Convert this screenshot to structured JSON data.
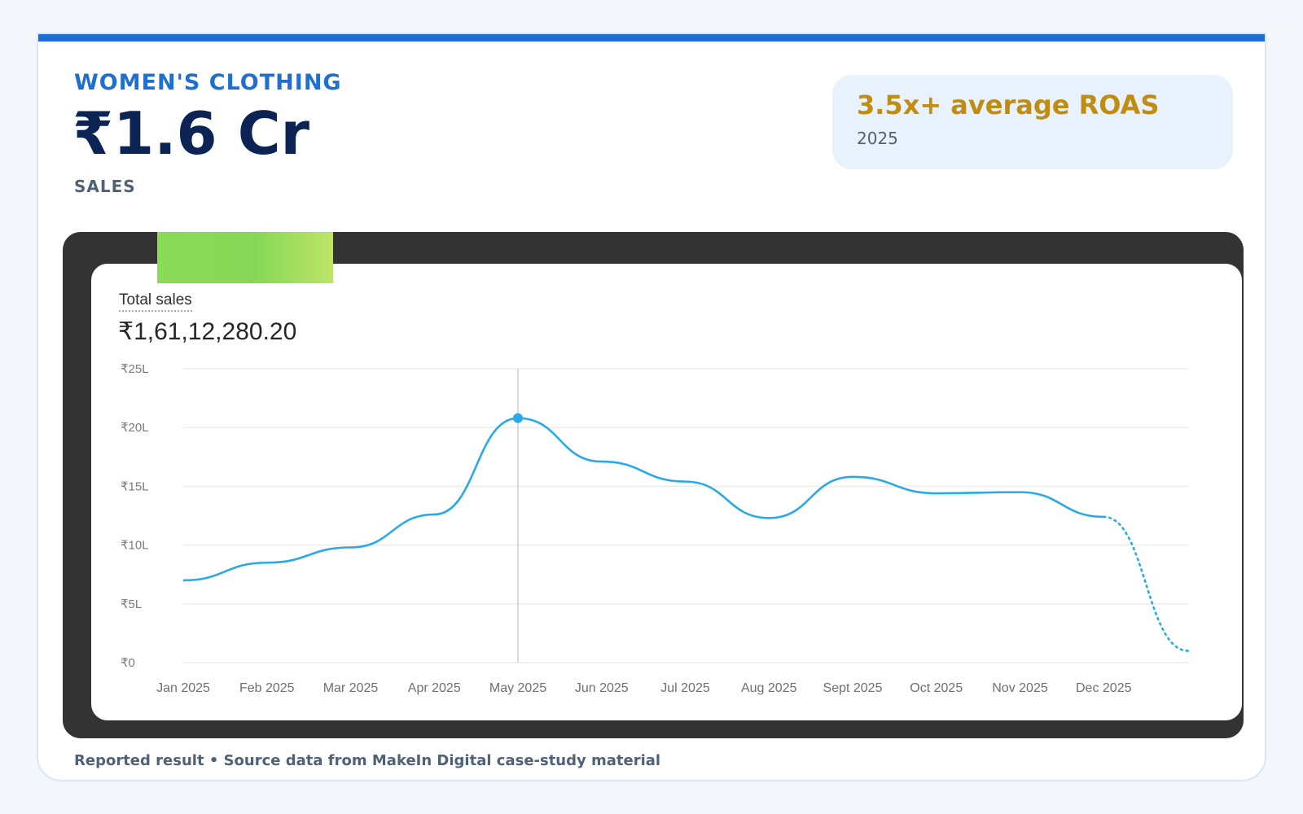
{
  "header": {
    "category": "WOMEN'S CLOTHING",
    "amount": "₹1.6 Cr",
    "amount_label": "SALES"
  },
  "badge": {
    "title": "3.5x+ average ROAS",
    "subtitle": "2025"
  },
  "chart_panel": {
    "label": "Total sales",
    "total": "₹1,61,12,280.20"
  },
  "footer": {
    "note": "Reported result • Source data from MakeIn Digital case-study material"
  },
  "colors": {
    "accent": "#1f6fd1",
    "gold": "#c08d12",
    "line": "#2aa9e6"
  },
  "chart_data": {
    "type": "line",
    "title": "Total sales",
    "categories": [
      "Jan 2025",
      "Feb 2025",
      "Mar 2025",
      "Apr 2025",
      "May 2025",
      "Jun 2025",
      "Jul 2025",
      "Aug 2025",
      "Sept 2025",
      "Oct 2025",
      "Nov 2025",
      "Dec 2025"
    ],
    "y_ticks": [
      "₹0",
      "₹5L",
      "₹10L",
      "₹15L",
      "₹20L",
      "₹25L"
    ],
    "ylim": [
      0,
      25
    ],
    "y_unit": "lakh ₹",
    "series": [
      {
        "values": [
          7.0,
          8.5,
          9.8,
          12.6,
          20.8,
          17.1,
          15.4,
          12.3,
          15.8,
          14.4,
          14.5,
          12.4
        ],
        "projected_end": 1.0
      }
    ],
    "highlight_index": 4,
    "grid": true
  }
}
